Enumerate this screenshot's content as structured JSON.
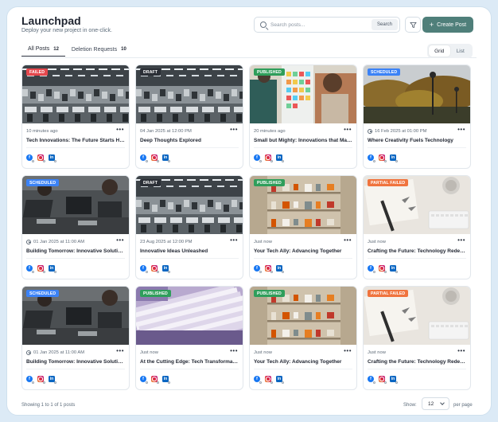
{
  "header": {
    "title": "Launchpad",
    "subtitle": "Deploy your new project in one-click.",
    "search_placeholder": "Search posts...",
    "search_button": "Search",
    "filter_icon": "filter-icon",
    "create_label": "Create Post"
  },
  "tabs": [
    {
      "label": "All Posts",
      "count": "12",
      "active": true
    },
    {
      "label": "Deletion Requests",
      "count": "10",
      "active": false
    }
  ],
  "view_toggle": {
    "grid": "Grid",
    "list": "List",
    "selected": "Grid"
  },
  "status_colors": {
    "FAILED": "#e5484d",
    "DRAFT": "#2b2f36",
    "PUBLISHED": "#2f9e5b",
    "SCHEDULED": "#3b82f6",
    "PARTIAL FAILED": "#f0743e"
  },
  "posts": [
    {
      "status": "FAILED",
      "time": "10 minutes ago",
      "scheduled": false,
      "title": "Tech Innovations: The Future Starts Here",
      "image": "office"
    },
    {
      "status": "DRAFT",
      "time": "04 Jan 2025 at 12:00 PM",
      "scheduled": false,
      "title": "Deep Thoughts Explored",
      "image": "office"
    },
    {
      "status": "PUBLISHED",
      "time": "20 minutes ago",
      "scheduled": false,
      "title": "Small but Mighty: Innovations that Make a Difference",
      "image": "whiteboard"
    },
    {
      "status": "SCHEDULED",
      "time": "16 Feb 2025 at 01:00 PM",
      "scheduled": true,
      "title": "Where Creativity Fuels Technology",
      "image": "park"
    },
    {
      "status": "SCHEDULED",
      "time": "01 Jan 2025 at 11:00 AM",
      "scheduled": true,
      "title": "Building Tomorrow: Innovative Solutions",
      "image": "laptops"
    },
    {
      "status": "DRAFT",
      "time": "23 Aug 2025 at 12:00 PM",
      "scheduled": false,
      "title": "Innovative Ideas Unleashed",
      "image": "office"
    },
    {
      "status": "PUBLISHED",
      "time": "Just now",
      "scheduled": false,
      "title": "Your Tech Ally: Advancing Together",
      "image": "shelves"
    },
    {
      "status": "PARTIAL FAILED",
      "time": "Just now",
      "scheduled": false,
      "title": "Crafting the Future: Technology Redefined",
      "image": "desk"
    },
    {
      "status": "SCHEDULED",
      "time": "01 Jan 2025 at 11:00 AM",
      "scheduled": true,
      "title": "Building Tomorrow: Innovative Solutions",
      "image": "laptops"
    },
    {
      "status": "PUBLISHED",
      "time": "Just now",
      "scheduled": false,
      "title": "At the Cutting Edge: Tech Transformations",
      "image": "papers"
    },
    {
      "status": "PUBLISHED",
      "time": "Just now",
      "scheduled": false,
      "title": "Your Tech Ally: Advancing Together",
      "image": "shelves"
    },
    {
      "status": "PARTIAL FAILED",
      "time": "Just now",
      "scheduled": false,
      "title": "Crafting the Future: Technology Redefined",
      "image": "desk"
    }
  ],
  "social_icons": [
    "facebook-icon",
    "instagram-icon",
    "linkedin-icon"
  ],
  "footer": {
    "showing": "Showing 1 to 1 of 1 posts",
    "show_label": "Show:",
    "per_page_value": "12",
    "per_page_label": "per page"
  }
}
